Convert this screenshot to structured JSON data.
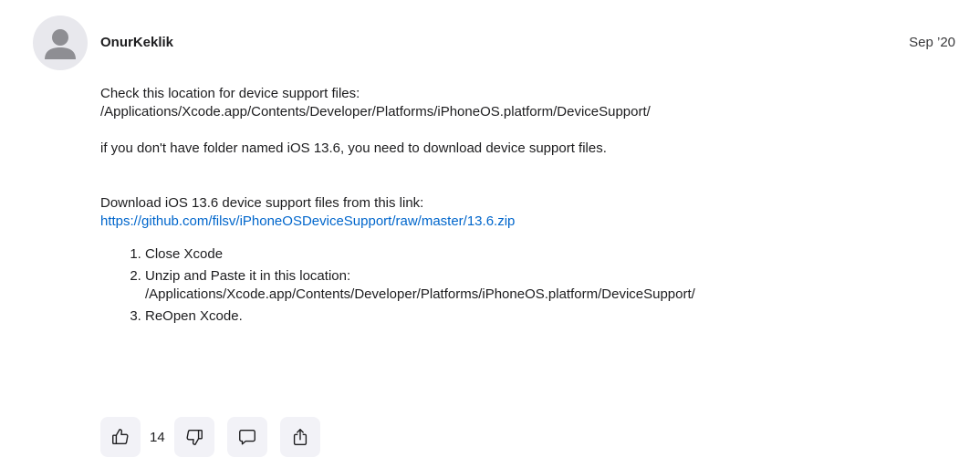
{
  "post": {
    "author": "OnurKeklik",
    "date": "Sep ’20",
    "avatar_icon": "person-icon",
    "paragraph1_line1": "Check this location for device support files:",
    "paragraph1_line2": "/Applications/Xcode.app/Contents/Developer/Platforms/iPhoneOS.platform/DeviceSupport/",
    "paragraph2": "if you don't have folder named iOS 13.6, you need to download device support files.",
    "paragraph3_line1": "Download iOS 13.6 device support files from this link:",
    "link": "https://github.com/filsv/iPhoneOSDeviceSupport/raw/master/13.6.zip",
    "steps": [
      "Close Xcode",
      "Unzip and Paste it in this location:",
      "/Applications/Xcode.app/Contents/Developer/Platforms/iPhoneOS.platform/DeviceSupport/",
      "ReOpen Xcode."
    ]
  },
  "actions": {
    "like_count": "14",
    "icons": [
      "thumbs-up-icon",
      "thumbs-down-icon",
      "comment-icon",
      "share-icon"
    ]
  },
  "colors": {
    "link": "#0066cc",
    "button_bg": "#f2f2f7",
    "avatar_bg": "#e8e8ed"
  }
}
